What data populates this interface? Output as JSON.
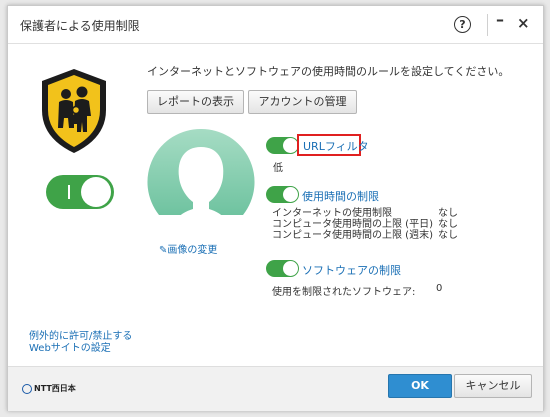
{
  "window": {
    "title": "保護者による使用制限",
    "help_glyph": "?",
    "minimize_glyph": "–",
    "close_glyph": "×"
  },
  "main": {
    "intro": "インターネットとソフトウェアの使用時間のルールを設定してください。",
    "report_button": "レポートの表示",
    "account_button": "アカウントの管理",
    "change_image": "画像の変更",
    "master_toggle": "on"
  },
  "settings": {
    "url_filter": {
      "label": "URLフィルタ",
      "level": "低",
      "enabled": true
    },
    "time_limit": {
      "label": "使用時間の制限",
      "enabled": true,
      "rows": [
        {
          "label": "インターネットの使用制限",
          "value": "なし"
        },
        {
          "label": "コンピュータ使用時間の上限 (平日)",
          "value": "なし"
        },
        {
          "label": "コンピュータ使用時間の上限 (週末)",
          "value": "なし"
        }
      ]
    },
    "software_limit": {
      "label": "ソフトウェアの制限",
      "enabled": true,
      "restricted_label": "使用を制限されたソフトウェア:",
      "restricted_count": "0"
    }
  },
  "links": {
    "exception_line1": "例外的に許可/禁止する",
    "exception_line2": "Webサイトの設定"
  },
  "footer": {
    "brand": "NTT西日本",
    "ok": "OK",
    "cancel": "キャンセル"
  },
  "colors": {
    "toggle_on": "#3fa348",
    "link": "#1a6fb5",
    "highlight_border": "#e02020",
    "primary_button": "#2f8ed1",
    "shield_yellow": "#f2c21b"
  }
}
